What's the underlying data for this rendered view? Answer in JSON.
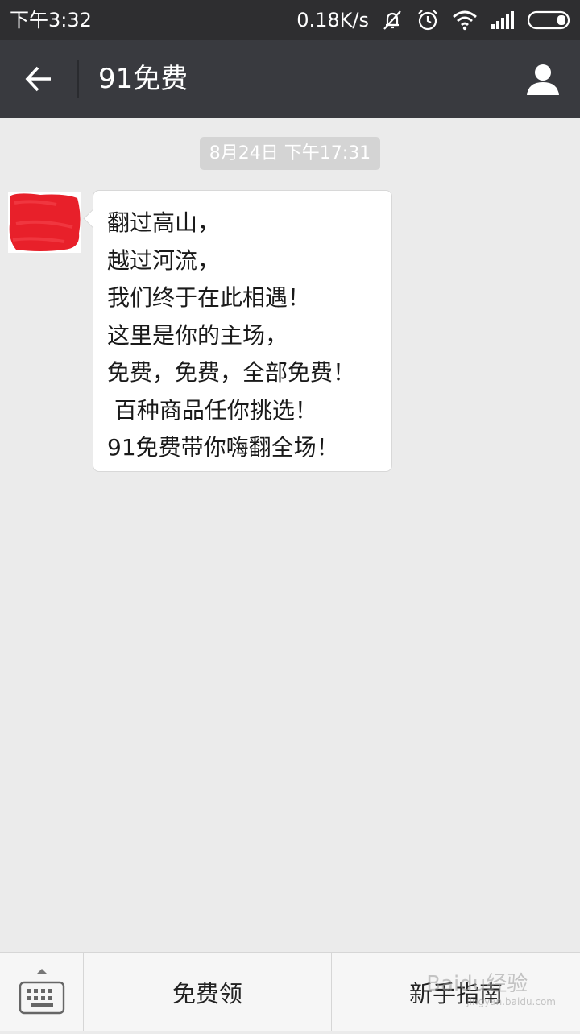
{
  "status_bar": {
    "time": "下午3:32",
    "network_speed": "0.18K/s",
    "icons": [
      "mute-icon",
      "alarm-icon",
      "wifi-icon",
      "signal-icon",
      "battery-icon"
    ]
  },
  "title_bar": {
    "title": "91免费",
    "back_icon": "back-arrow-icon",
    "profile_icon": "person-icon"
  },
  "chat": {
    "timestamp": "8月24日 下午17:31",
    "message": {
      "sender_avatar": "redacted-avatar",
      "text": "翻过高山，\n越过河流，\n我们终于在此相遇！\n这里是你的主场，\n免费，免费，全部免费！\n 百种商品任你挑选！\n91免费带你嗨翻全场！"
    }
  },
  "bottom_menu": {
    "keyboard_icon": "keyboard-icon",
    "items": [
      {
        "label": "免费领"
      },
      {
        "label": "新手指南"
      }
    ]
  },
  "watermark": {
    "line1": "Baidu经验",
    "line2": "jingyan.baidu.com"
  },
  "colors": {
    "status_bar": "#2e2e30",
    "title_bar": "#393a3f",
    "background": "#ebebeb",
    "bubble": "#ffffff",
    "avatar_red": "#e8202a"
  }
}
